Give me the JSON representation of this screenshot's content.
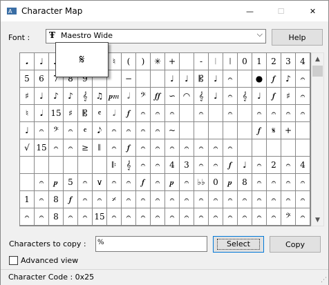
{
  "window": {
    "title": "Character Map",
    "status_text": "Character Code : 0x25"
  },
  "titlebar": {
    "min": "—",
    "max": "☐",
    "close": "✕"
  },
  "font": {
    "label": "Font :",
    "selected": "Maestro Wide",
    "tt_glyph": "Ŧ",
    "dropdown": "⌵"
  },
  "help_label": "Help",
  "popup_glyph": "𝄋",
  "grid": {
    "cells": [
      "𝅘",
      "♩",
      "♪",
      "♫",
      "♬",
      "♭",
      "♮",
      "(",
      ")",
      "✳",
      "+",
      "",
      "-",
      "𝄀",
      "𝄁",
      "0",
      "1",
      "2",
      "3",
      "4",
      "5",
      "6",
      "7",
      "8",
      "9",
      "",
      "",
      "−",
      "",
      "",
      "♩",
      "♩",
      "𝄡",
      "♩",
      "𝄐",
      "",
      "●",
      "𝆑",
      "♪",
      "𝄐",
      "♯",
      "♩",
      "♪",
      "♪",
      "𝄞",
      "♫",
      "𝆏𝆐",
      "𝅗𝅥",
      "𝄢",
      "𝆑𝆑",
      "∽",
      "◠",
      "𝄞",
      "♩",
      "𝄐",
      "𝄞",
      "♩",
      "𝆑",
      "♯",
      "𝄐",
      "♮",
      "𝅘𝅥",
      "15",
      "♯",
      "𝄡",
      "𝄴",
      "𝅗𝅥",
      "𝆑",
      "𝄐",
      "𝄐",
      "𝄐",
      "",
      "𝄐",
      "",
      "𝄐",
      "",
      "𝄐",
      "𝄐",
      "𝄐",
      "𝄐",
      "♩",
      "𝄐",
      "𝄢",
      "𝄐",
      "𝄴",
      "𝅘𝅥𝅮",
      "𝄐",
      "𝄐",
      "𝄐",
      "𝄐",
      "~",
      "",
      "",
      "",
      "",
      "",
      "𝆑",
      "𝄋",
      "+",
      "",
      "√",
      "15",
      "𝄐",
      "𝄐",
      "≥",
      "𝄃",
      "𝄐",
      "𝆑",
      "𝄐",
      "𝄐",
      "𝄐",
      "𝄐",
      "𝄐",
      "𝄐",
      "𝄐",
      "",
      "",
      "",
      "",
      "",
      "",
      "",
      "",
      "",
      "",
      "",
      "𝄆",
      "𝄞",
      "𝄐",
      "𝄐",
      "4",
      "3",
      "𝄐",
      "𝄐",
      "𝆑",
      "♩",
      "𝄐",
      "2",
      "𝄐",
      "4",
      "",
      "𝄐",
      "𝆏",
      "5",
      "𝄐",
      "∨",
      "𝄐",
      "𝄐",
      "𝆑",
      "𝄐",
      "𝆏",
      "𝄐",
      "♭♭",
      "0",
      "𝆏",
      "8",
      "𝄐",
      "𝄐",
      "𝄐",
      "𝄐",
      "1",
      "𝄐",
      "8",
      "𝆑",
      "𝄐",
      "𝄐",
      "𝄎",
      "𝄐",
      "𝄐",
      "𝄐",
      "𝄐",
      "𝄐",
      "𝄐",
      "𝄐",
      "𝄐",
      "𝄐",
      "𝄐",
      "𝄐",
      "𝄐",
      "𝄐",
      "𝄐",
      "𝄐",
      "8",
      "𝄐",
      "𝄐",
      "15",
      "𝄐",
      "𝄐",
      "𝄐",
      "𝄐",
      "𝄐",
      "𝄐",
      "𝄐",
      "𝄐",
      "𝄐",
      "𝄐",
      "𝄐",
      "𝄐",
      "𝄢",
      "𝄐"
    ]
  },
  "copy": {
    "label": "Characters to copy :",
    "value": "%",
    "select_label": "Select",
    "copy_label": "Copy"
  },
  "advanced": {
    "label": "Advanced view"
  }
}
